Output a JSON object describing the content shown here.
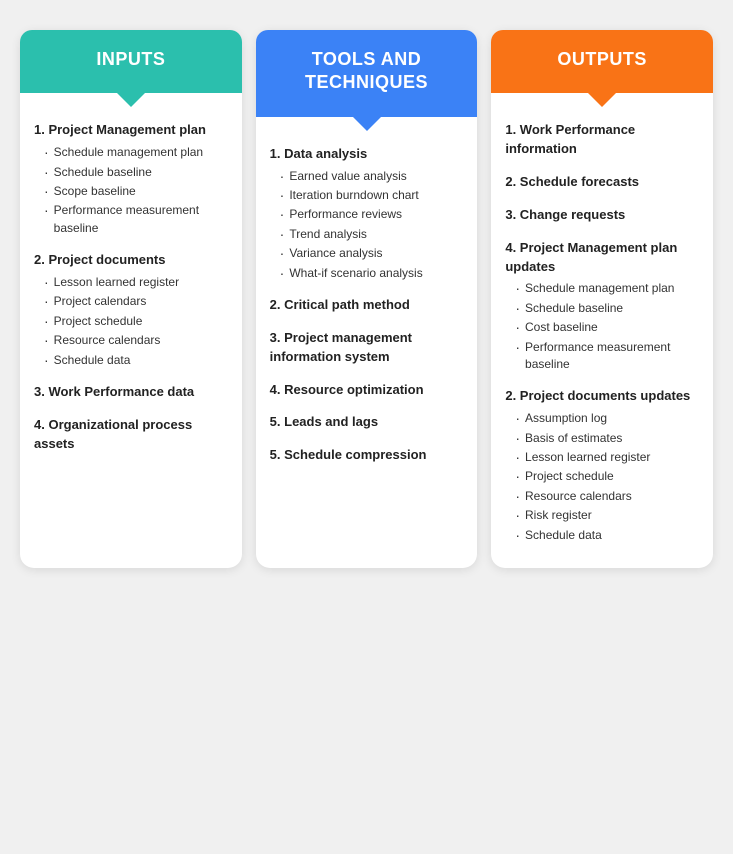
{
  "columns": [
    {
      "id": "inputs",
      "header": "INPUTS",
      "headerClass": "inputs-header",
      "items": [
        {
          "label": "1. Project Management plan",
          "subitems": [
            "Schedule management plan",
            "Schedule baseline",
            "Scope baseline",
            "Performance measurement baseline"
          ]
        },
        {
          "label": "2. Project documents",
          "subitems": [
            "Lesson learned register",
            "Project calendars",
            "Project schedule",
            "Resource calendars",
            "Schedule data"
          ]
        },
        {
          "label": "3. Work Performance data",
          "subitems": []
        },
        {
          "label": "4. Organizational process assets",
          "subitems": []
        }
      ]
    },
    {
      "id": "tools",
      "header": "TOOLS AND TECHNIQUES",
      "headerClass": "tools-header",
      "items": [
        {
          "label": "1. Data analysis",
          "subitems": [
            "Earned value analysis",
            "Iteration burndown chart",
            "Performance reviews",
            "Trend analysis",
            "Variance analysis",
            "What-if scenario analysis"
          ]
        },
        {
          "label": "2. Critical path method",
          "subitems": []
        },
        {
          "label": "3. Project management information system",
          "subitems": []
        },
        {
          "label": "4. Resource optimization",
          "subitems": []
        },
        {
          "label": "5. Leads and lags",
          "subitems": []
        },
        {
          "label": "5. Schedule compression",
          "subitems": []
        }
      ]
    },
    {
      "id": "outputs",
      "header": "OUTPUTS",
      "headerClass": "outputs-header",
      "items": [
        {
          "label": "1. Work Performance information",
          "subitems": []
        },
        {
          "label": "2. Schedule forecasts",
          "subitems": []
        },
        {
          "label": "3. Change requests",
          "subitems": []
        },
        {
          "label": "4. Project Management plan updates",
          "subitems": [
            "Schedule management plan",
            "Schedule baseline",
            "Cost baseline",
            "Performance measurement baseline"
          ]
        },
        {
          "label": "2. Project documents updates",
          "subitems": [
            "Assumption log",
            "Basis of estimates",
            "Lesson learned register",
            "Project schedule",
            "Resource calendars",
            "Risk register",
            "Schedule data"
          ]
        }
      ]
    }
  ]
}
